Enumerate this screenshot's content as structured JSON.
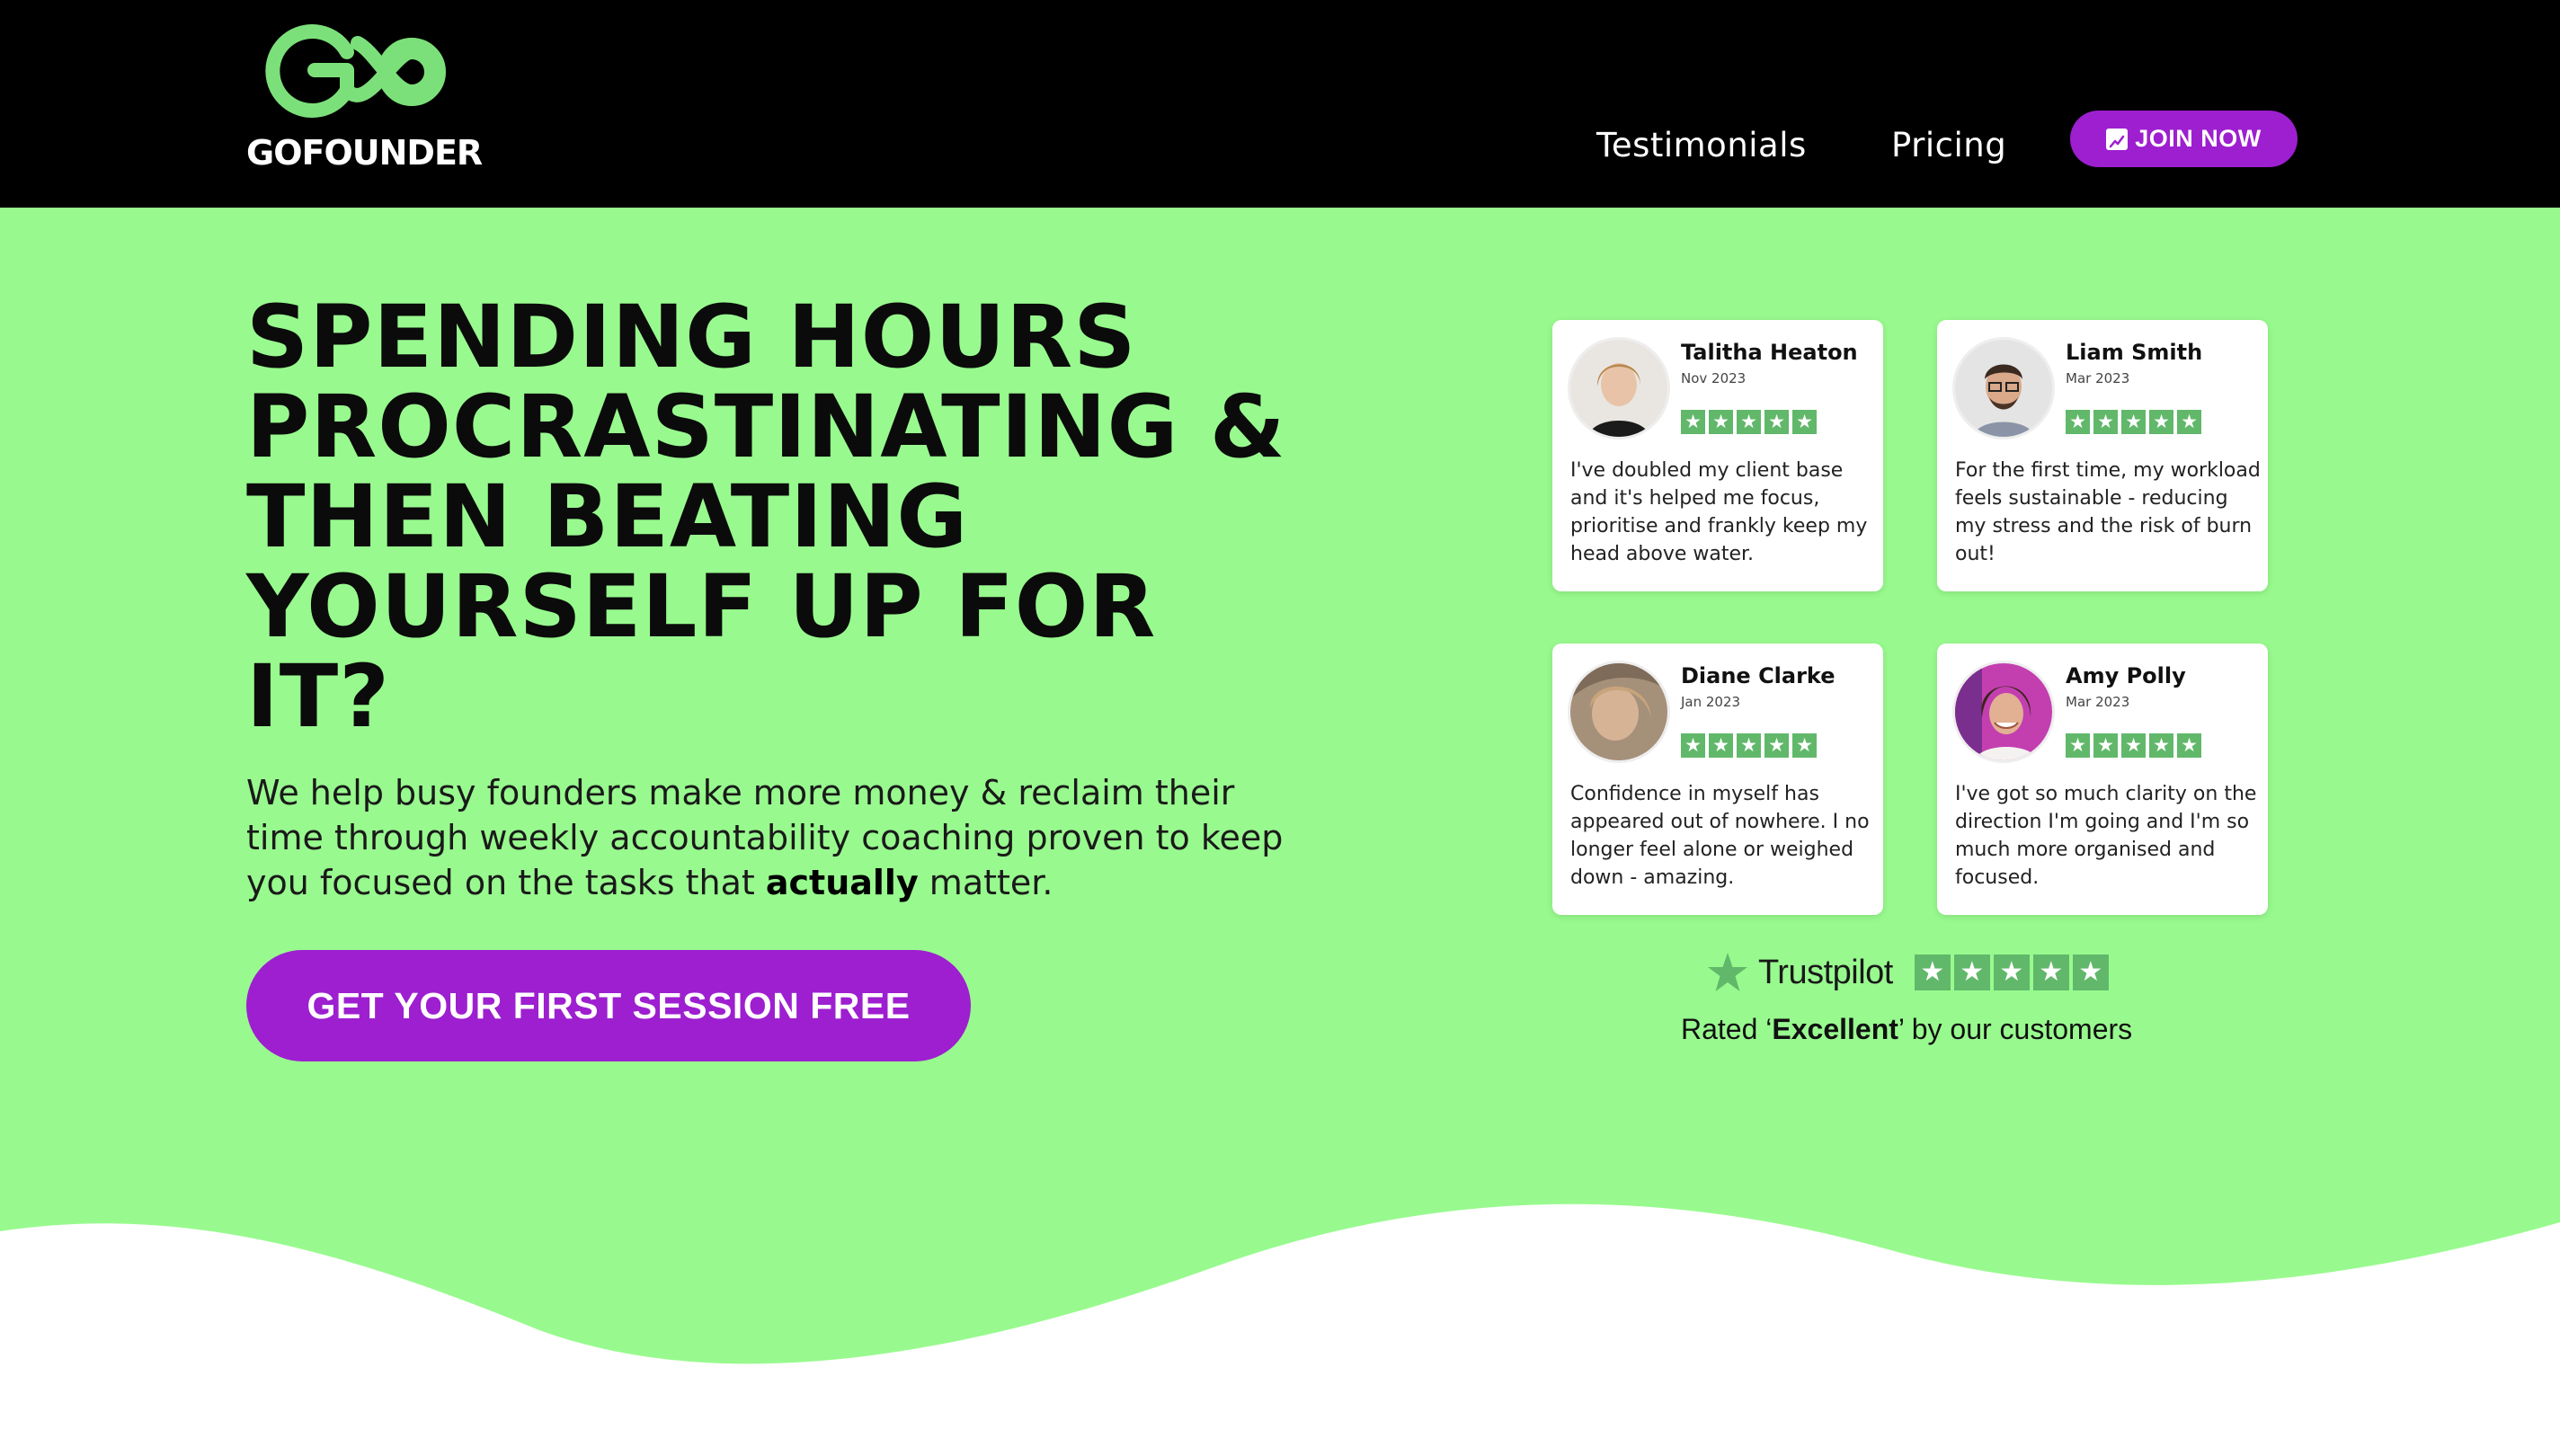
{
  "header": {
    "logo_text": "GOFOUNDER",
    "nav": [
      {
        "label": "Testimonials"
      },
      {
        "label": "Pricing"
      }
    ],
    "join_button": {
      "label": "JOIN NOW",
      "icon": "chart-up-icon"
    }
  },
  "hero": {
    "headline": "SPENDING HOURS PROCRASTINATING & THEN BEATING YOURSELF UP FOR IT?",
    "subtext_before": "We help busy founders make more money & reclaim their time through weekly accountability coaching proven to keep you focused on the tasks that ",
    "subtext_bold": "actually",
    "subtext_after": " matter.",
    "cta_label": "GET YOUR FIRST SESSION FREE"
  },
  "reviews": [
    {
      "name": "Talitha Heaton",
      "date": "Nov 2023",
      "rating": 5,
      "text": "I've doubled my client base and it's helped me focus, prioritise and frankly keep my head above water."
    },
    {
      "name": "Liam Smith",
      "date": "Mar 2023",
      "rating": 5,
      "text": "For the first time, my workload feels sustainable - reducing my stress and the risk of burn out!"
    },
    {
      "name": "Diane Clarke",
      "date": "Jan 2023",
      "rating": 5,
      "text": "Confidence in myself has appeared out of nowhere. I no longer feel alone or weighed down - amazing."
    },
    {
      "name": "Amy Polly",
      "date": "Mar 2023",
      "rating": 5,
      "text": "I've got so much clarity on the direction I'm going and I'm so much more organised and focused."
    }
  ],
  "trustpilot": {
    "brand": "Trustpilot",
    "rating": 5,
    "rated_prefix": "Rated ‘",
    "rated_word": "Excellent",
    "rated_suffix": "’ by our customers"
  },
  "colors": {
    "header_bg": "#000000",
    "hero_bg": "#98fa8e",
    "accent_purple": "#9d1fd0",
    "logo_green": "#7ce07a",
    "star_green": "#61b86a"
  }
}
